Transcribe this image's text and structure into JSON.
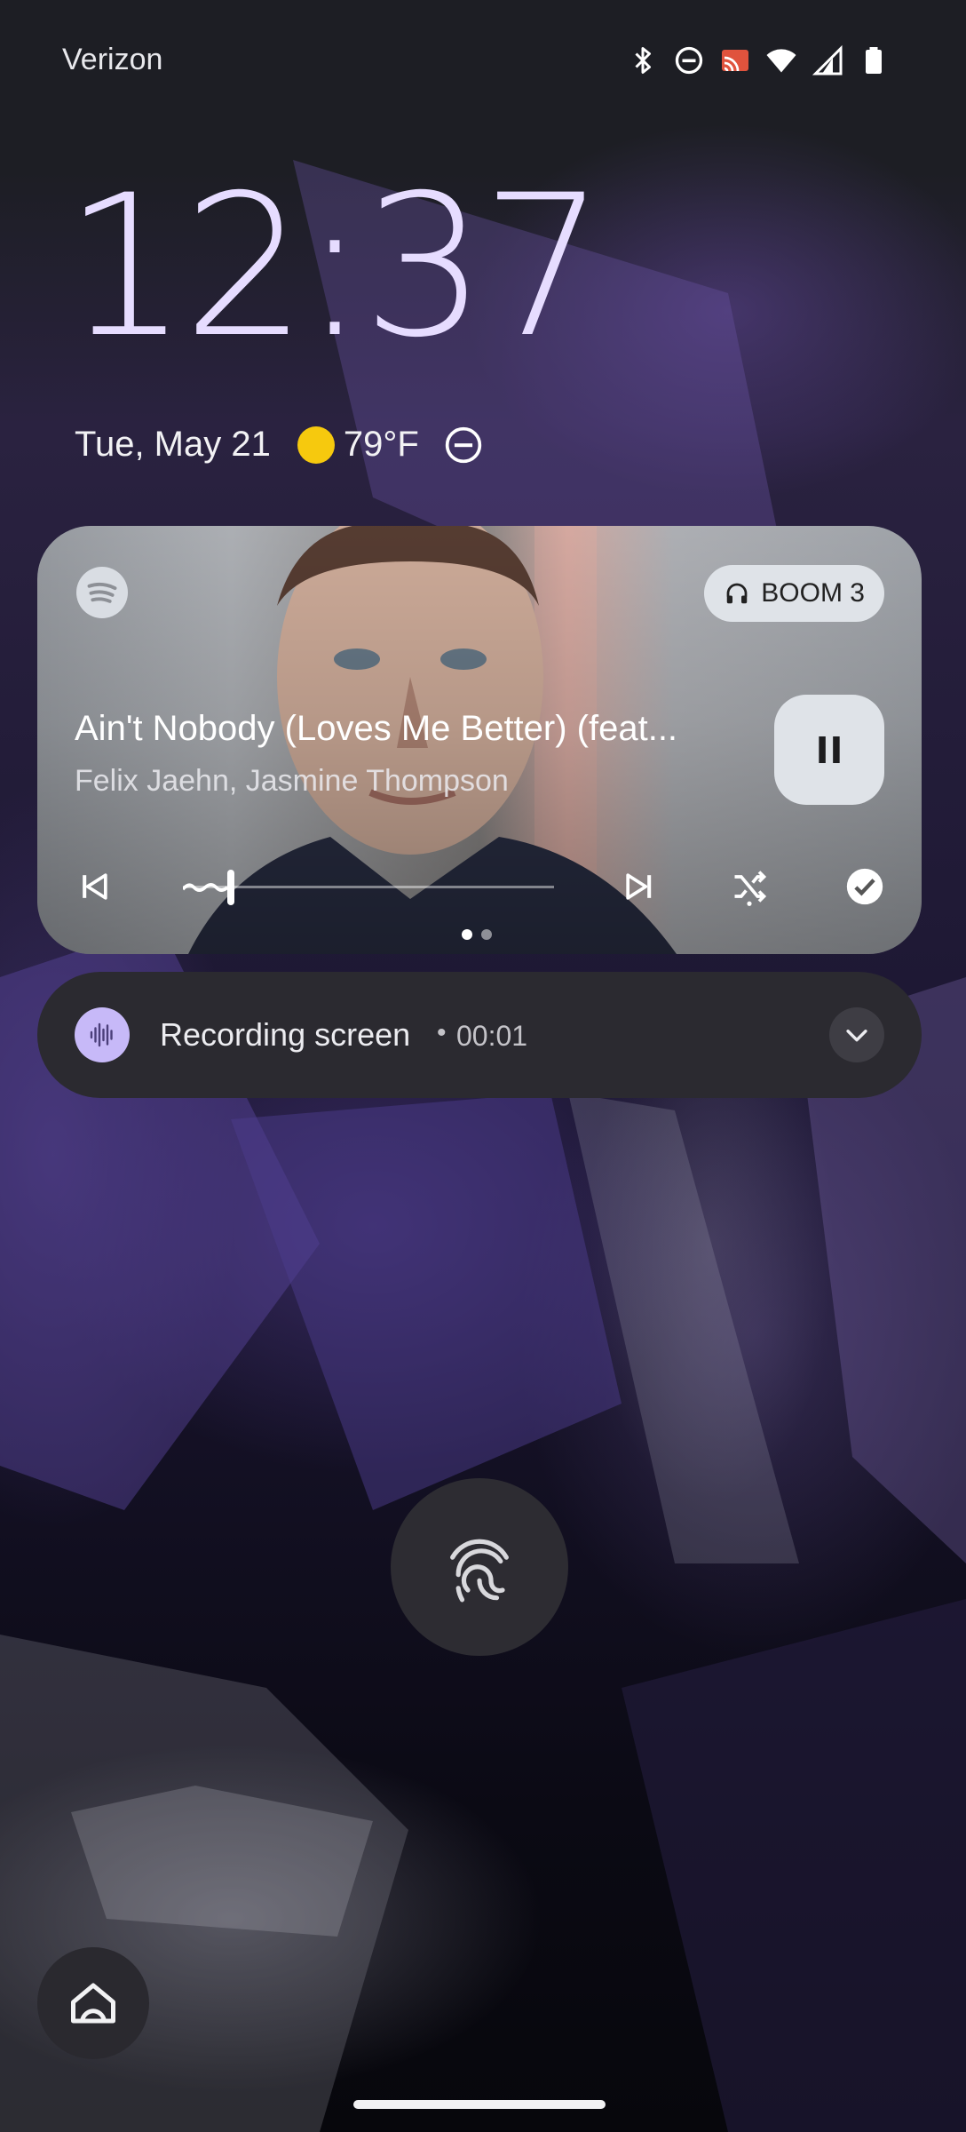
{
  "status_bar": {
    "carrier": "Verizon",
    "icons": [
      "bluetooth-icon",
      "do-not-disturb-icon",
      "cast-icon",
      "wifi-icon",
      "cell-signal-icon",
      "battery-icon"
    ]
  },
  "lockscreen": {
    "time": "12:37",
    "date": "Tue, May 21",
    "weather_icon": "sunny-icon",
    "temperature": "79°F",
    "dnd_icon": "do-not-disturb-icon"
  },
  "media": {
    "app": "spotify-icon",
    "output_device": "BOOM 3",
    "track_title": "Ain't Nobody (Loves Me Better) (feat...",
    "artist": "Felix Jaehn, Jasmine Thompson",
    "play_state_icon": "pause-icon",
    "progress": 0.12,
    "page_count": 2,
    "active_page": 0
  },
  "notification": {
    "icon": "sound-wave-icon",
    "title": "Recording screen",
    "separator": "•",
    "elapsed": "00:01"
  },
  "colors": {
    "clock": "#e6dcff",
    "weather_sun": "#f6c90e",
    "recording_icon_bg": "#c7b9f8",
    "chip_bg": "#dfe3e8",
    "spotify_gray": "#d9dde3"
  }
}
